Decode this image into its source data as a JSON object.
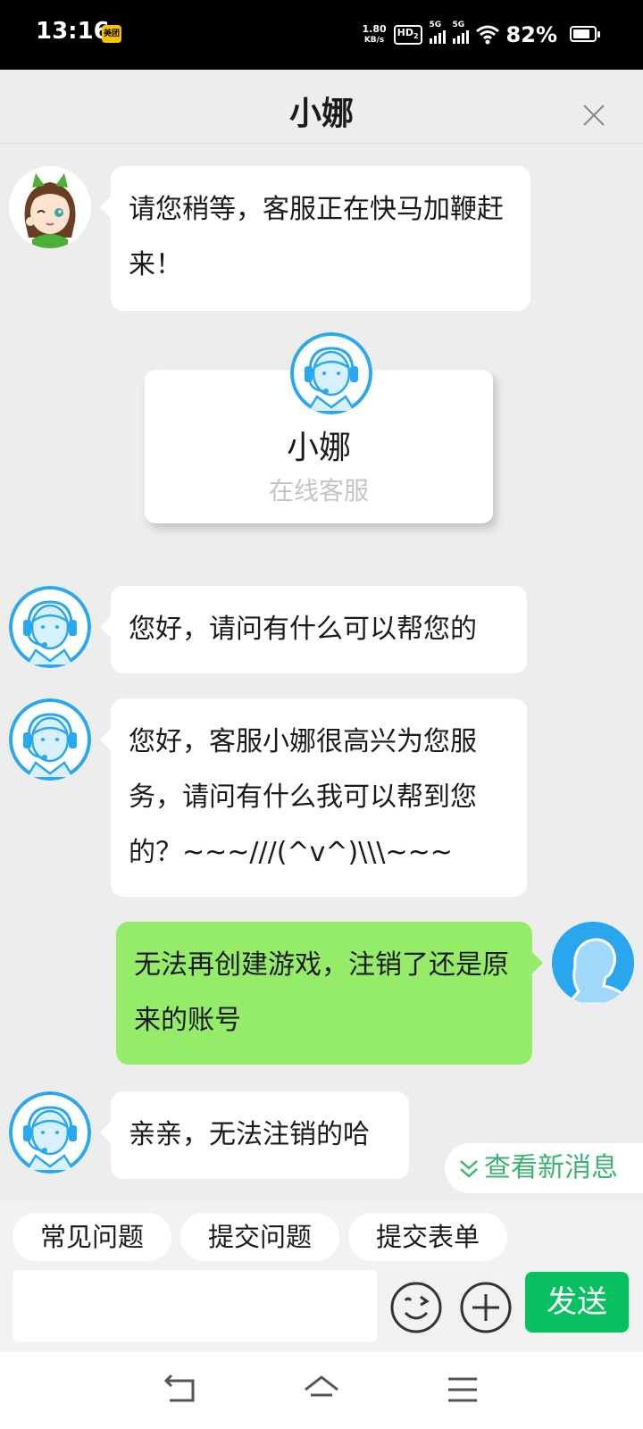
{
  "status_bar": {
    "time": "13:16",
    "app_icon_text": "美团",
    "net_speed_value": "1.80",
    "net_speed_unit": "KB/s",
    "hd_label": "HD",
    "hd_sub": "2",
    "signal1_label": "5G",
    "signal2_label": "5G",
    "battery_percent": "82%",
    "battery_level": 0.82
  },
  "header": {
    "title": "小娜"
  },
  "messages": [
    {
      "sender": "bot",
      "text": "请您稍等，客服正在快马加鞭赶来！"
    },
    {
      "sender": "agent",
      "text": "您好，请问有什么可以帮您的"
    },
    {
      "sender": "agent",
      "text": "您好，客服小娜很高兴为您服务，请问有什么我可以帮到您的？~~~///(^v^)\\\\\\~~~"
    },
    {
      "sender": "user",
      "text": "无法再创建游戏，注销了还是原来的账号"
    },
    {
      "sender": "agent",
      "text": "亲亲，无法注销的哈"
    }
  ],
  "agent_card": {
    "name": "小娜",
    "role": "在线客服"
  },
  "new_messages_label": "查看新消息",
  "quick_replies": [
    "常见问题",
    "提交问题",
    "提交表单"
  ],
  "input": {
    "value": "",
    "placeholder": ""
  },
  "send_label": "发送",
  "colors": {
    "user_bubble": "#95ec69",
    "send_button": "#07c160",
    "new_msg_text": "#3cb371",
    "agent_avatar_blue": "#29a8f0"
  }
}
